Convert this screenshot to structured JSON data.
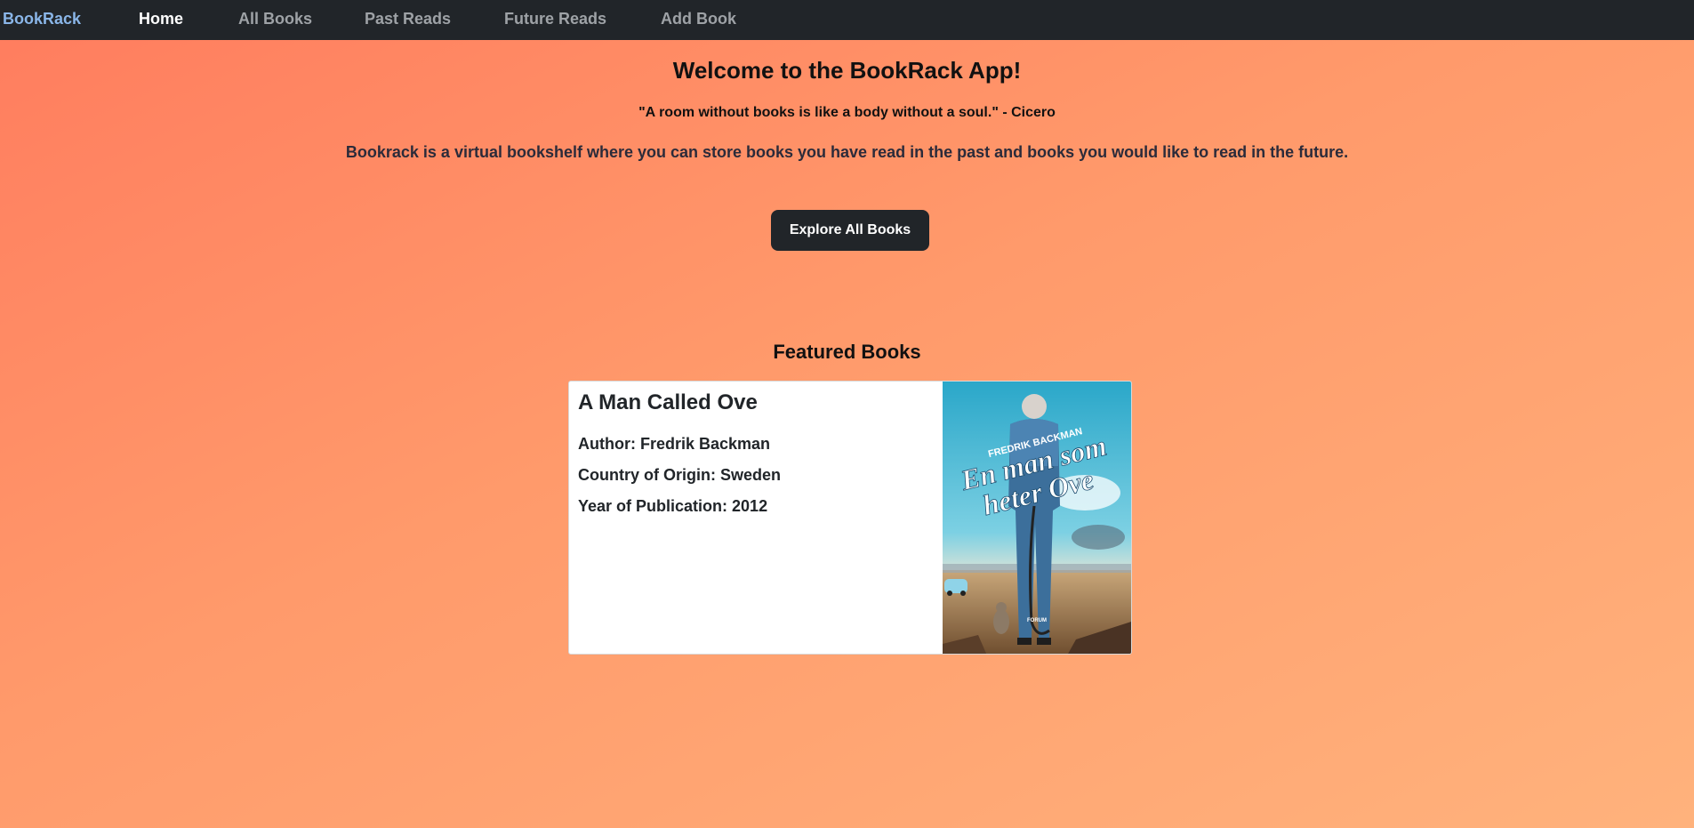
{
  "nav": {
    "brand": "BookRack",
    "items": [
      {
        "label": "Home",
        "active": true
      },
      {
        "label": "All Books",
        "active": false
      },
      {
        "label": "Past Reads",
        "active": false
      },
      {
        "label": "Future Reads",
        "active": false
      },
      {
        "label": "Add Book",
        "active": false
      }
    ]
  },
  "hero": {
    "title": "Welcome to the BookRack App!",
    "quote": "\"A room without books is like a body without a soul.\" - Cicero",
    "description": "Bookrack is a virtual bookshelf where you can store books you have read in the past and books you would like to read in the future.",
    "button_label": "Explore All Books"
  },
  "featured": {
    "heading": "Featured Books",
    "book": {
      "title": "A Man Called Ove",
      "author_line": "Author: Fredrik Backman",
      "country_line": "Country of Origin: Sweden",
      "year_line": "Year of Publication: 2012",
      "cover": {
        "author_text": "FREDRIK BACKMAN",
        "title_line1": "En man som",
        "title_line2": "heter Ove",
        "publisher": "FORUM"
      }
    }
  },
  "colors": {
    "navbar_bg": "#212529",
    "brand": "#8ab6e8",
    "nav_active": "#ffffff",
    "nav_inactive": "#9ea2a6",
    "bg_start": "#ff7c5e",
    "bg_end": "#ffb27c",
    "button_bg": "#212529"
  }
}
